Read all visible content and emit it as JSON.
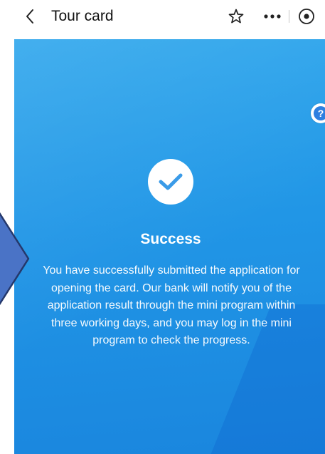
{
  "header": {
    "title": "Tour card",
    "icons": {
      "back": "back-chevron-icon",
      "favorite": "star-outline-icon",
      "more": "more-dots-icon",
      "record": "record-target-icon"
    }
  },
  "help": {
    "label": "?",
    "icon": "help-icon"
  },
  "result": {
    "icon": "checkmark-icon",
    "title": "Success",
    "message": "You have successfully submitted the application for opening the card. Our bank will notify you of the application result through the mini program within three working days, and you may log in the mini program to check the progress."
  },
  "colors": {
    "panel_blue": "#2196e6",
    "check_blue": "#3a9be8",
    "arrow_blue": "#4a73c6",
    "arrow_outline": "#25386b"
  }
}
